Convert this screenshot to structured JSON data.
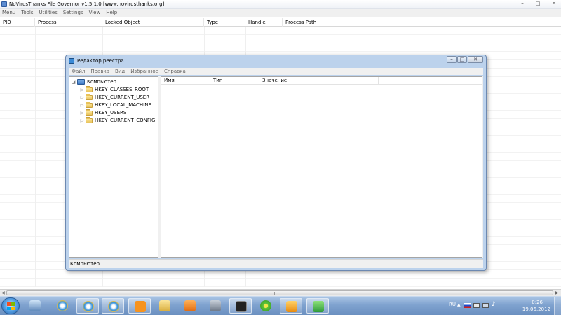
{
  "main_window": {
    "title": "NoVirusThanks File Governor v1.5.1.0 [www.novirusthanks.org]",
    "controls": {
      "minimize": "–",
      "maximize": "□",
      "close": "✕"
    },
    "menu": [
      "Menu",
      "Tools",
      "Utilities",
      "Settings",
      "View",
      "Help"
    ],
    "columns": [
      "PID",
      "Process",
      "Locked Object",
      "Type",
      "Handle",
      "Process Path"
    ]
  },
  "registry_editor": {
    "title": "Редактор реестра",
    "controls": {
      "minimize": "–",
      "maximize": "□",
      "close": "✕"
    },
    "menu": [
      "Файл",
      "Правка",
      "Вид",
      "Избранное",
      "Справка"
    ],
    "tree": {
      "root": "Компьютер",
      "children": [
        "HKEY_CLASSES_ROOT",
        "HKEY_CURRENT_USER",
        "HKEY_LOCAL_MACHINE",
        "HKEY_USERS",
        "HKEY_CURRENT_CONFIG"
      ]
    },
    "list_columns": [
      "Имя",
      "Тип",
      "Значение"
    ],
    "status": "Компьютер"
  },
  "taskbar": {
    "items": [
      "file-manager",
      "internet-explorer",
      "internet-explorer-2",
      "internet-explorer-3",
      "odnoklassniki",
      "folder",
      "media-player",
      "utility",
      "game",
      "icq",
      "winamp-like",
      "file-governor"
    ],
    "tray": {
      "language": "RU",
      "time": "0:26",
      "date": "19.06.2012"
    }
  }
}
